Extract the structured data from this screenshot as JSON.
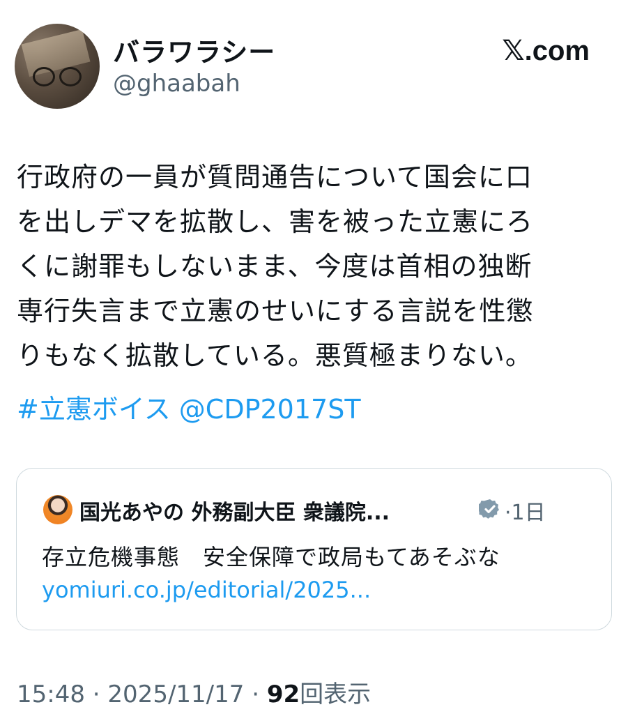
{
  "author": {
    "display_name": "バラワラシー",
    "handle": "@ghaabah"
  },
  "brand": "𝕏.com",
  "tweet": {
    "text": "行政府の一員が質問通告について国会に口\nを出しデマを拡散し、害を被った立憲にろ\nくに謝罪もしないまま、今度は首相の独断\n専行失言まで立憲のせいにする言説を性懲\nりもなく拡散している。悪質極まりない。",
    "hashtag": "#立憲ボイス",
    "mention": "@CDP2017ST"
  },
  "quoted": {
    "author_name": "国光あやの 外務副大臣 衆議院...",
    "time": "·1日",
    "text": "存立危機事態　安全保障で政局もてあそぶな",
    "link": "yomiuri.co.jp/editorial/2025..."
  },
  "meta": {
    "time": "15:48",
    "sep1": " · ",
    "date": "2025/11/17",
    "sep2": " · ",
    "views": "92",
    "views_label": "回表示"
  },
  "colors": {
    "accent": "#1d9bf0",
    "secondary_text": "#536471",
    "border": "#cfd9de",
    "verified": "#829aab"
  }
}
